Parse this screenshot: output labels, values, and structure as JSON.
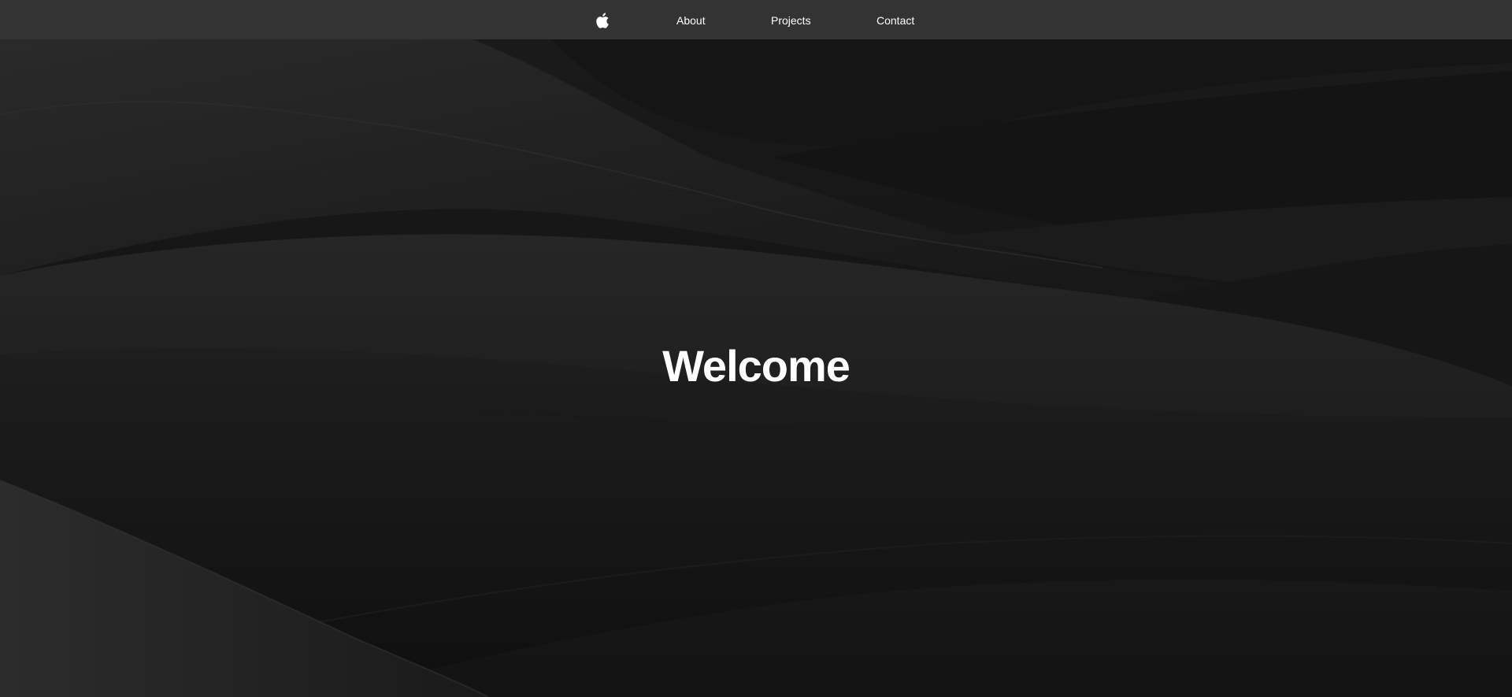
{
  "nav": {
    "logo_icon": "apple-logo-icon",
    "links": [
      {
        "label": "About"
      },
      {
        "label": "Projects"
      },
      {
        "label": "Contact"
      }
    ]
  },
  "hero": {
    "title": "Welcome"
  },
  "colors": {
    "navbar_bg": "#333333",
    "text": "#ffffff",
    "hero_bg": "#121212"
  }
}
